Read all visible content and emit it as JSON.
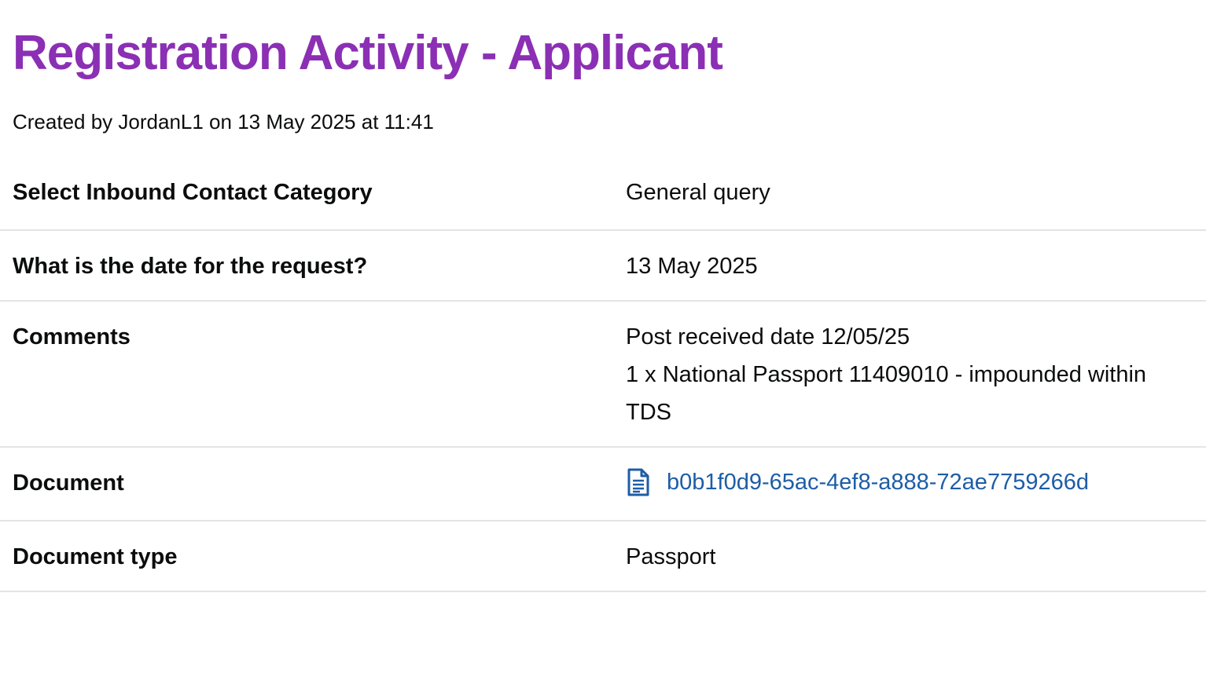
{
  "page": {
    "title": "Registration Activity - Applicant",
    "created_by": "Created by JordanL1 on 13 May 2025 at 11:41"
  },
  "colors": {
    "title": "#8b2fb4",
    "link": "#1d5da6",
    "text": "#0b0c0c",
    "divider": "#e2e4e6"
  },
  "summary": {
    "rows": [
      {
        "key": "Select Inbound Contact Category",
        "value": "General query"
      },
      {
        "key": "What is the date for the request?",
        "value": "13 May 2025"
      },
      {
        "key": "Comments",
        "lines": [
          "Post received date 12/05/25",
          "1 x National Passport 11409010 - impounded within",
          "TDS"
        ]
      },
      {
        "key": "Document",
        "link_text": "b0b1f0d9-65ac-4ef8-a888-72ae7759266d",
        "icon": "document-icon"
      },
      {
        "key": "Document type",
        "value": "Passport"
      }
    ]
  }
}
